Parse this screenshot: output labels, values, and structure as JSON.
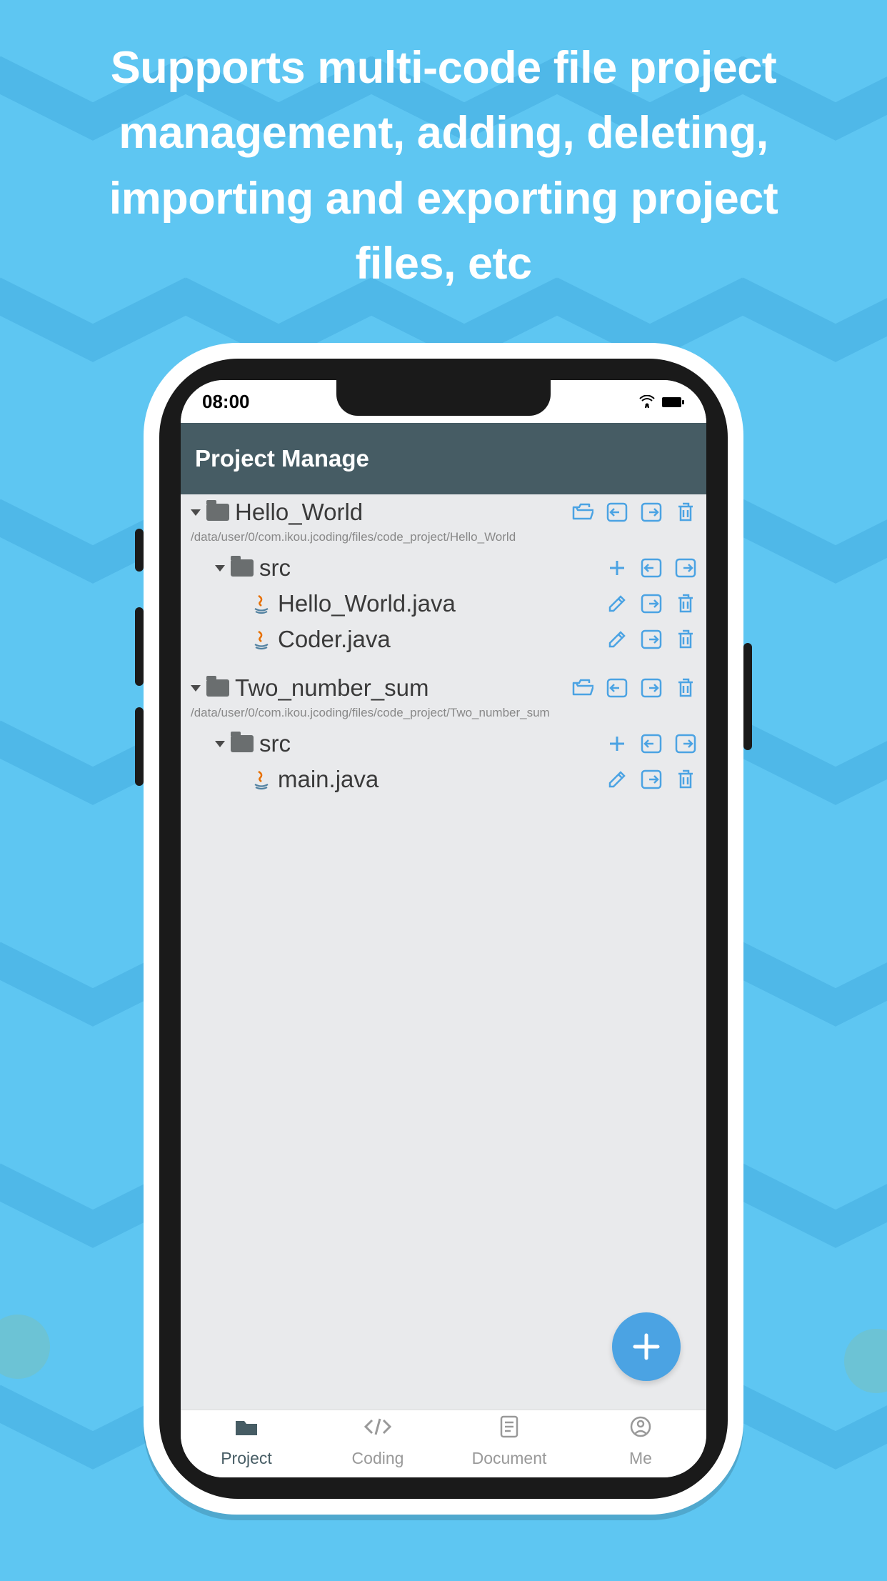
{
  "hero": "Supports multi-code file project management,  adding, deleting, importing and exporting project files, etc",
  "status_time": "08:00",
  "header_title": "Project Manage",
  "projects": [
    {
      "name": "Hello_World",
      "path": "/data/user/0/com.ikou.jcoding/files/code_project/Hello_World",
      "folders": [
        {
          "name": "src",
          "files": [
            {
              "name": "Hello_World.java"
            },
            {
              "name": "Coder.java"
            }
          ]
        }
      ]
    },
    {
      "name": "Two_number_sum",
      "path": "/data/user/0/com.ikou.jcoding/files/code_project/Two_number_sum",
      "folders": [
        {
          "name": "src",
          "files": [
            {
              "name": "main.java"
            }
          ]
        }
      ]
    }
  ],
  "nav": {
    "project": "Project",
    "coding": "Coding",
    "document": "Document",
    "me": "Me"
  }
}
